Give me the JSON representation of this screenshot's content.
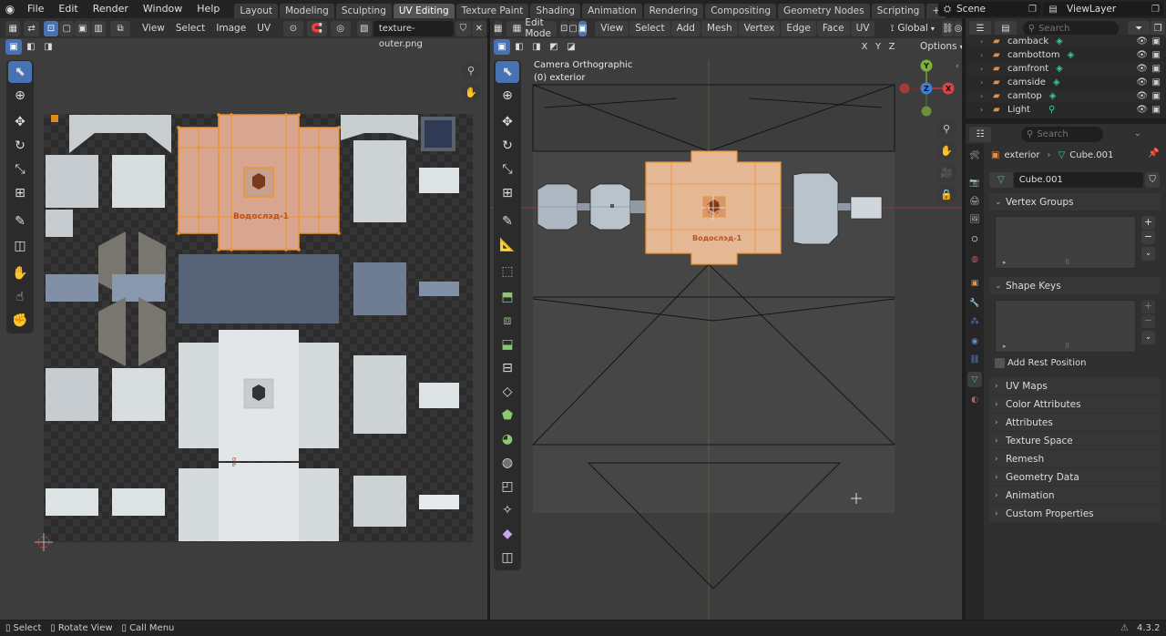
{
  "topbar": {
    "menus": [
      "File",
      "Edit",
      "Render",
      "Window",
      "Help"
    ],
    "workspaces": [
      "Layout",
      "Modeling",
      "Sculpting",
      "UV Editing",
      "Texture Paint",
      "Shading",
      "Animation",
      "Rendering",
      "Compositing",
      "Geometry Nodes",
      "Scripting"
    ],
    "active_workspace": "UV Editing",
    "scene": "Scene",
    "view_layer": "ViewLayer"
  },
  "uv_editor": {
    "menus": [
      "View",
      "Select",
      "Image",
      "UV"
    ],
    "image_name": "texture-outer.png",
    "label_vodoslad": "Водослэд-1",
    "label_bay": "ЕНЬ"
  },
  "viewport": {
    "mode": "Edit Mode",
    "menus": [
      "View",
      "Select",
      "Add",
      "Mesh",
      "Vertex",
      "Edge",
      "Face",
      "UV"
    ],
    "orientation": "Global",
    "axes": [
      "X",
      "Y",
      "Z"
    ],
    "options_label": "Options",
    "view_title": "Camera Orthographic",
    "view_subtitle": "(0) exterior",
    "label_vodoslad": "Водослэд-1",
    "gizmo": {
      "x": "X",
      "y": "Y",
      "z": "Z"
    }
  },
  "outliner": {
    "search_placeholder": "Search",
    "items": [
      {
        "name": "camback"
      },
      {
        "name": "cambottom"
      },
      {
        "name": "camfront"
      },
      {
        "name": "camside"
      },
      {
        "name": "camtop"
      },
      {
        "name": "Light"
      }
    ]
  },
  "properties": {
    "search_placeholder": "Search",
    "breadcrumb_object": "exterior",
    "breadcrumb_mesh": "Cube.001",
    "mesh_name": "Cube.001",
    "sections": {
      "vertex_groups": "Vertex Groups",
      "shape_keys": "Shape Keys",
      "add_rest_position": "Add Rest Position",
      "uv_maps": "UV Maps",
      "color_attributes": "Color Attributes",
      "attributes": "Attributes",
      "texture_space": "Texture Space",
      "remesh": "Remesh",
      "geometry_data": "Geometry Data",
      "animation": "Animation",
      "custom_properties": "Custom Properties"
    }
  },
  "statusbar": {
    "select": "Select",
    "rotate_view": "Rotate View",
    "call_menu": "Call Menu",
    "version": "4.3.2"
  }
}
